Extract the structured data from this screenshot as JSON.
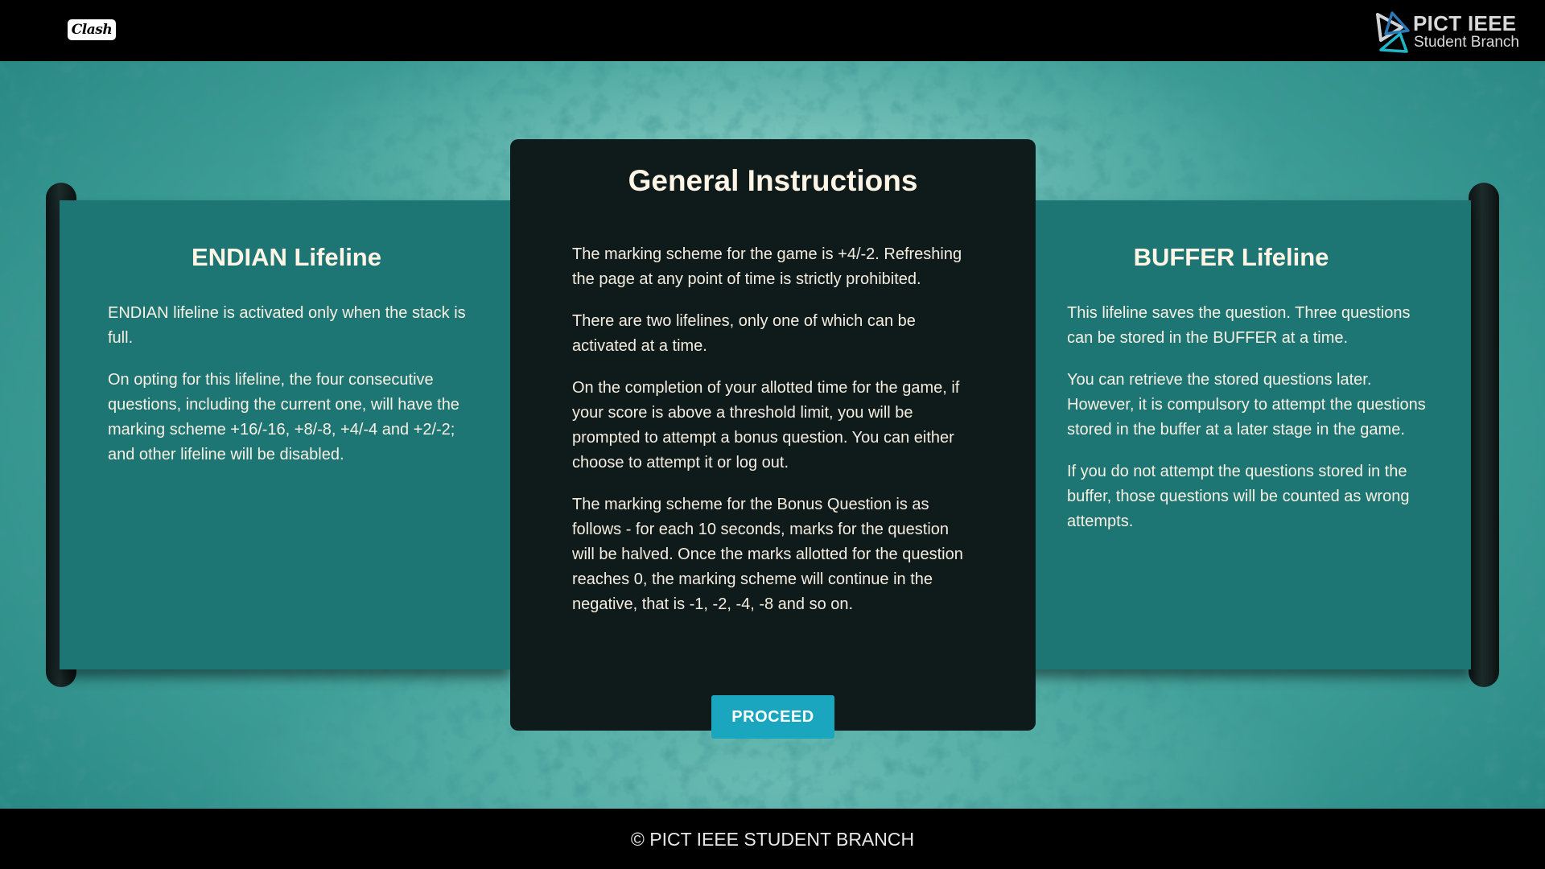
{
  "header": {
    "app_logo": {
      "name": "clash-logo",
      "text": "Clash"
    },
    "org_logo": {
      "icon": "pict-ieee-triangle-icon",
      "title": "PICT IEEE",
      "subtitle": "Student Branch"
    }
  },
  "colors": {
    "background": "#4aa9a1",
    "side_panel": "#1e7674",
    "center_card": "#0f1a1b",
    "accent_button": "#1ba6c0",
    "title_text": "#fff5e6"
  },
  "left_panel": {
    "title": "ENDIAN Lifeline",
    "paragraphs": [
      "ENDIAN lifeline is activated only when the stack is full.",
      "On opting for this lifeline, the four consecutive questions, including the current one, will have the marking scheme +16/-16, +8/-8, +4/-4 and +2/-2; and other lifeline will be disabled."
    ]
  },
  "center_panel": {
    "title": "General Instructions",
    "paragraphs": [
      "The marking scheme for the game is +4/-2. Refreshing the page at any point of time is strictly prohibited.",
      "There are two lifelines, only one of which can be activated at a time.",
      "On the completion of your allotted time for the game, if your score is above a threshold limit, you will be prompted to attempt a bonus question. You can either choose to attempt it or log out.",
      "The marking scheme for the Bonus Question is as follows - for each 10 seconds, marks for the question will be halved. Once the marks allotted for the question reaches 0, the marking scheme will continue in the negative, that is -1, -2, -4, -8 and so on."
    ],
    "proceed_label": "PROCEED"
  },
  "right_panel": {
    "title": "BUFFER Lifeline",
    "paragraphs": [
      "This lifeline saves the question. Three questions can be stored in the BUFFER at a time.",
      "You can retrieve the stored questions later. However, it is compulsory to attempt the questions stored in the buffer at a later stage in the game.",
      "If you do not attempt the questions stored in the buffer, those questions will be counted as wrong attempts."
    ]
  },
  "footer": {
    "text": "© PICT IEEE STUDENT BRANCH"
  }
}
